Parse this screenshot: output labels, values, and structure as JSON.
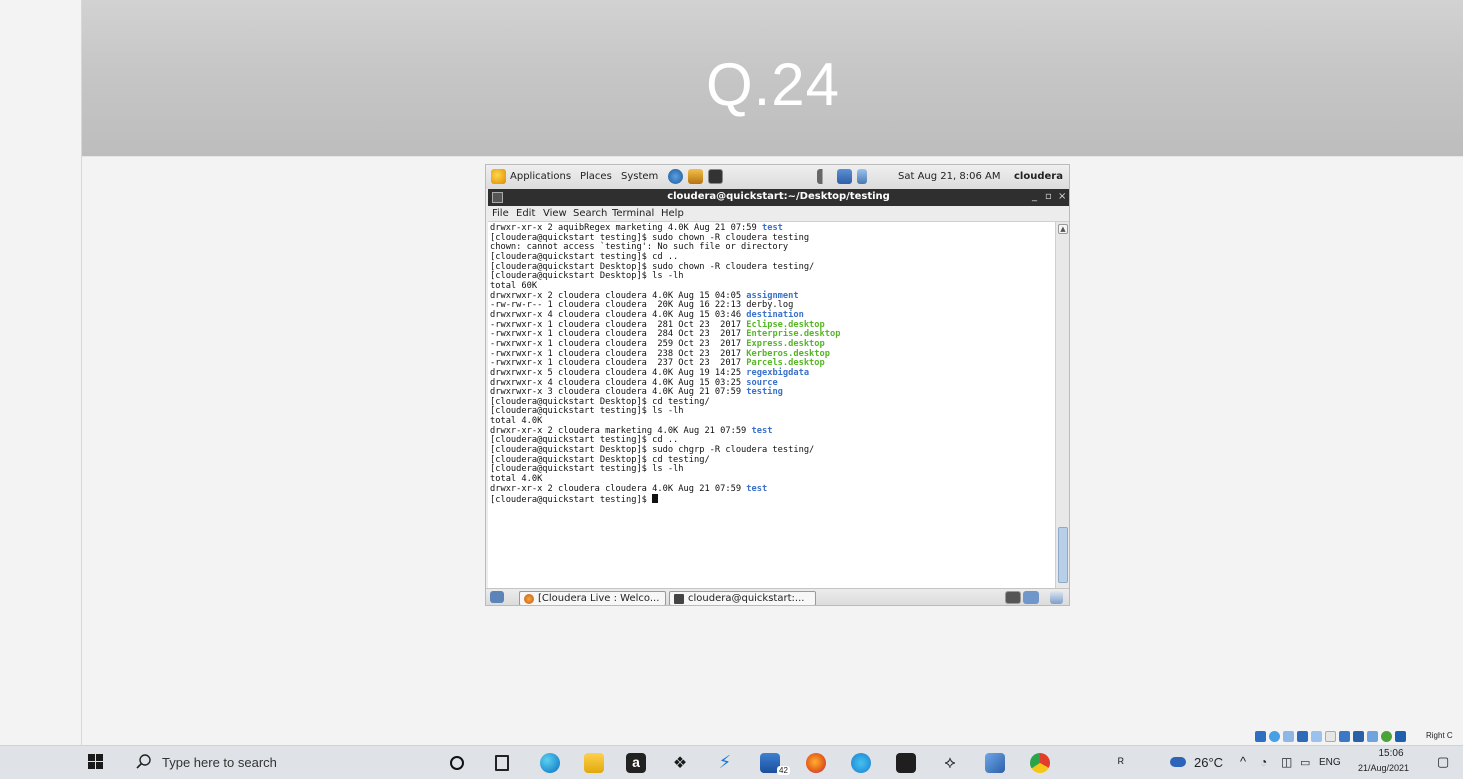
{
  "slide": {
    "title": "Q.24"
  },
  "gnome_panel": {
    "menus": [
      "Applications",
      "Places",
      "System"
    ],
    "clock": "Sat Aug 21,  8:06 AM",
    "user": "cloudera"
  },
  "terminal": {
    "title": "cloudera@quickstart:~/Desktop/testing",
    "window_buttons": [
      "_",
      "▫",
      "×"
    ],
    "menu": [
      "File",
      "Edit",
      "View",
      "Search",
      "Terminal",
      "Help"
    ],
    "lines": [
      {
        "text": "drwxr-xr-x 2 aquibRegex marketing 4.0K Aug 21 07:59 ",
        "name": "test",
        "kind": "dir"
      },
      {
        "text": "[cloudera@quickstart testing]$ sudo chown -R cloudera testing"
      },
      {
        "text": "chown: cannot access `testing': No such file or directory"
      },
      {
        "text": "[cloudera@quickstart testing]$ cd .."
      },
      {
        "text": "[cloudera@quickstart Desktop]$ sudo chown -R cloudera testing/"
      },
      {
        "text": "[cloudera@quickstart Desktop]$ ls -lh"
      },
      {
        "text": "total 60K"
      },
      {
        "text": "drwxrwxr-x 2 cloudera cloudera 4.0K Aug 15 04:05 ",
        "name": "assignment",
        "kind": "dir"
      },
      {
        "text": "-rw-rw-r-- 1 cloudera cloudera  20K Aug 16 22:13 derby.log"
      },
      {
        "text": "drwxrwxr-x 4 cloudera cloudera 4.0K Aug 15 03:46 ",
        "name": "destination",
        "kind": "dir"
      },
      {
        "text": "-rwxrwxr-x 1 cloudera cloudera  281 Oct 23  2017 ",
        "name": "Eclipse.desktop",
        "kind": "exe"
      },
      {
        "text": "-rwxrwxr-x 1 cloudera cloudera  284 Oct 23  2017 ",
        "name": "Enterprise.desktop",
        "kind": "exe"
      },
      {
        "text": "-rwxrwxr-x 1 cloudera cloudera  259 Oct 23  2017 ",
        "name": "Express.desktop",
        "kind": "exe"
      },
      {
        "text": "-rwxrwxr-x 1 cloudera cloudera  238 Oct 23  2017 ",
        "name": "Kerberos.desktop",
        "kind": "exe"
      },
      {
        "text": "-rwxrwxr-x 1 cloudera cloudera  237 Oct 23  2017 ",
        "name": "Parcels.desktop",
        "kind": "exe"
      },
      {
        "text": "drwxrwxr-x 5 cloudera cloudera 4.0K Aug 19 14:25 ",
        "name": "regexbigdata",
        "kind": "dir"
      },
      {
        "text": "drwxrwxr-x 4 cloudera cloudera 4.0K Aug 15 03:25 ",
        "name": "source",
        "kind": "dir"
      },
      {
        "text": "drwxrwxr-x 3 cloudera cloudera 4.0K Aug 21 07:59 ",
        "name": "testing",
        "kind": "dir"
      },
      {
        "text": "[cloudera@quickstart Desktop]$ cd testing/"
      },
      {
        "text": "[cloudera@quickstart testing]$ ls -lh"
      },
      {
        "text": "total 4.0K"
      },
      {
        "text": "drwxr-xr-x 2 cloudera marketing 4.0K Aug 21 07:59 ",
        "name": "test",
        "kind": "dir"
      },
      {
        "text": "[cloudera@quickstart testing]$ cd .."
      },
      {
        "text": "[cloudera@quickstart Desktop]$ sudo chgrp -R cloudera testing/"
      },
      {
        "text": "[cloudera@quickstart Desktop]$ cd testing/"
      },
      {
        "text": "[cloudera@quickstart testing]$ ls -lh"
      },
      {
        "text": "total 4.0K"
      },
      {
        "text": "drwxr-xr-x 2 cloudera cloudera 4.0K Aug 21 07:59 ",
        "name": "test",
        "kind": "dir"
      },
      {
        "text": "[cloudera@quickstart testing]$ ",
        "cursor": true
      }
    ]
  },
  "vm_taskbar": {
    "tasks": [
      "[Cloudera Live : Welco...",
      "cloudera@quickstart:..."
    ]
  },
  "tray_strip": {
    "label": "Right C"
  },
  "windows_taskbar": {
    "search_placeholder": "Type here to search",
    "badge_count": "42",
    "temperature": "26°C",
    "language": "ENG",
    "time": "15:06",
    "date": "21/Aug/2021"
  },
  "colors": {
    "dir": "#3a71c9",
    "exe": "#56b626"
  }
}
